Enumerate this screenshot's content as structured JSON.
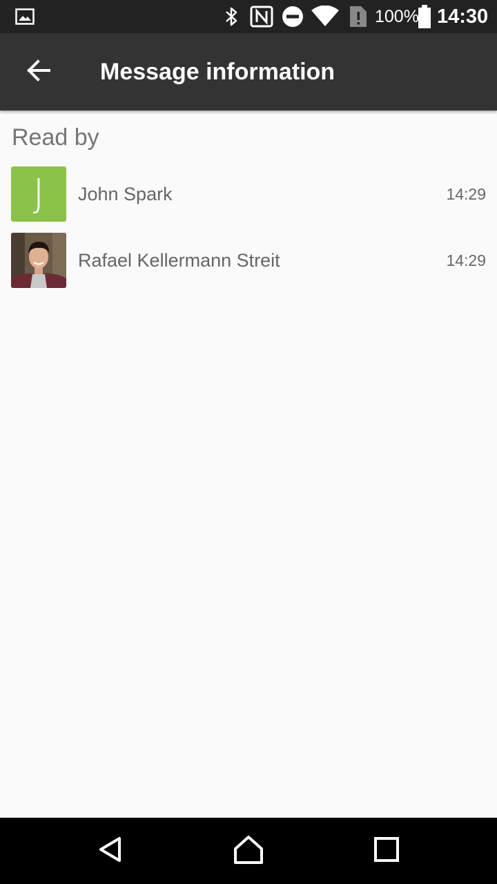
{
  "status_bar": {
    "battery_percent": "100%",
    "time": "14:30",
    "icons": [
      "image-icon",
      "bluetooth-icon",
      "nfc-icon",
      "do-not-disturb-icon",
      "wifi-icon",
      "sim-alert-icon",
      "battery-icon"
    ]
  },
  "app_bar": {
    "title": "Message information",
    "back_icon": "arrow-back-icon"
  },
  "read_by": {
    "header": "Read by",
    "readers": [
      {
        "name": "John Spark",
        "time": "14:29",
        "avatar_letter": "J",
        "avatar_color": "#8bc34a"
      },
      {
        "name": "Rafael Kellermann Streit",
        "time": "14:29",
        "avatar_type": "photo"
      }
    ]
  },
  "nav_bar": {
    "icons": [
      "back-triangle-icon",
      "home-icon",
      "recents-icon"
    ]
  },
  "colors": {
    "status_bar": "#222222",
    "app_bar": "#333333",
    "background": "#fafafa",
    "nav_bar": "#000000",
    "secondary_text": "#757575"
  }
}
